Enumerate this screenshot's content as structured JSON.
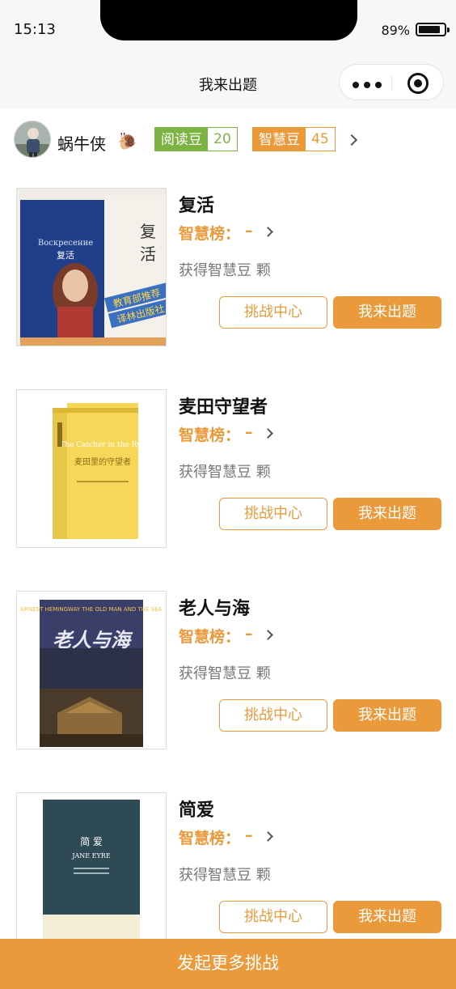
{
  "status_bar": {
    "time": "15:13",
    "battery": "89%"
  },
  "nav": {
    "title": "我来出题"
  },
  "user": {
    "name": "蜗牛侠",
    "emoji": "🐌",
    "read_beans_label": "阅读豆",
    "read_beans_value": "20",
    "wisdom_beans_label": "智慧豆",
    "wisdom_beans_value": "45"
  },
  "books": [
    {
      "title": "复活",
      "rank_label": "智慧榜：",
      "rank_value": "–",
      "earn_text": "获得智慧豆 颗",
      "challenge_label": "挑战中心",
      "ask_label": "我来出题",
      "cover_title": "复活",
      "cover_sub": "Воскресение",
      "cover_tag": "教育部推荐",
      "cover_tag2": "译林出版社"
    },
    {
      "title": "麦田守望者",
      "rank_label": "智慧榜：",
      "rank_value": "–",
      "earn_text": "获得智慧豆 颗",
      "challenge_label": "挑战中心",
      "ask_label": "我来出题",
      "cover_title": "麦田里的守望者",
      "cover_sub": "The Catcher in the Rye"
    },
    {
      "title": "老人与海",
      "rank_label": "智慧榜：",
      "rank_value": "–",
      "earn_text": "获得智慧豆 颗",
      "challenge_label": "挑战中心",
      "ask_label": "我来出题",
      "cover_title": "老人与海",
      "cover_sub": "ERNEST HEMINGWAY THE OLD MAN AND THE SEA"
    },
    {
      "title": "简爱",
      "rank_label": "智慧榜：",
      "rank_value": "–",
      "earn_text": "获得智慧豆 颗",
      "challenge_label": "挑战中心",
      "ask_label": "我来出题",
      "cover_title": "简 爱",
      "cover_sub": "JANE EYRE"
    }
  ],
  "bottom": {
    "cta_label": "发起更多挑战"
  },
  "colors": {
    "accent": "#eb9a3b",
    "green": "#7cb342",
    "separator": "#e6e6e6"
  }
}
